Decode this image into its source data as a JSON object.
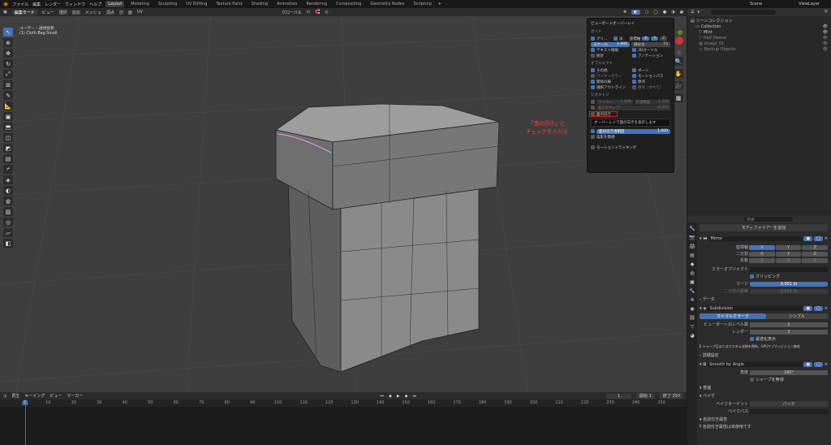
{
  "menubar": {
    "menus": [
      "ファイル",
      "編集",
      "レンダー",
      "ウィンドウ",
      "ヘルプ"
    ],
    "workspaces": [
      "Layout",
      "Modeling",
      "Sculpting",
      "UV Editing",
      "Texture Paint",
      "Shading",
      "Animation",
      "Rendering",
      "Compositing",
      "Geometry Nodes",
      "Scripting"
    ],
    "active_workspace": "Layout",
    "scene_label": "Scene",
    "viewlayer_label": "ViewLayer"
  },
  "viewport_header": {
    "mode": "編集モード",
    "menus": [
      "ビュー",
      "選択",
      "追加",
      "メッシュ",
      "頂点",
      "辺",
      "面",
      "UV"
    ],
    "orientation": "グローバル"
  },
  "viewport": {
    "view_name": "ユーザー・透視投影",
    "object_name": "(1) Cloth Bag.Small"
  },
  "overlay_panel": {
    "title": "ビューポートオーバーレイ",
    "guides_title": "ガイド",
    "grid_label": "グリ...",
    "floor_label": "床",
    "axes_label": "座標軸",
    "axis_x": "X",
    "axis_y": "Y",
    "axis_z": "Z",
    "scale_label": "スケール",
    "scale_value": "1.000",
    "subdiv_label": "細分化",
    "subdiv_value": "10",
    "text_info": "テキスト情報",
    "cursor_3d": "3Dカーソル",
    "stats": "統計",
    "annotations": "アノテーション",
    "objects_title": "オブジェクト",
    "extras": "その他",
    "bones": "ボーン",
    "wireframe": "ワイヤーカラー",
    "motion_paths": "モーションパス",
    "relations": "関係の線",
    "origins": "原点",
    "outline_selected": "選択アウトライン",
    "origins_all": "原点（すべて）",
    "geometry_title": "ジオメトリ",
    "wire_label": "ワイヤー",
    "wire_value": "1.000",
    "opacity_label": "不透明度",
    "opacity_value": "1.000",
    "fade_label": "非アクティブ",
    "fade_value": "0.400",
    "face_orientation": "面の向き",
    "tooltip": "オーバーレイで面の向きを表示します",
    "face_alpha_label": "面の向き透明度",
    "face_alpha_value": "1.000",
    "hidden_wire": "陰影を無視",
    "motion_tracking": "モーショントラッキング"
  },
  "annotation": {
    "line1": "「面の向き」に",
    "line2": "チェックを入れる"
  },
  "outliner": {
    "title": "シーンコレクション",
    "items": [
      {
        "name": "Collection"
      },
      {
        "name": "Mint"
      },
      {
        "name": "Half Sleeve"
      },
      {
        "name": "image_01"
      },
      {
        "name": "Backup Objects"
      }
    ]
  },
  "properties": {
    "search_placeholder": "検索",
    "add_modifier": "モディファイアーを追加",
    "mirror": {
      "name": "Mirror",
      "axis_label": "座標軸",
      "bisect_label": "二分割",
      "flip_label": "反転",
      "x": "X",
      "y": "Y",
      "z": "Z",
      "mirror_object_label": "ミラーオブジェクト",
      "clipping": "クリッピング",
      "merge_label": "マージ",
      "merge_value": "0.001 m",
      "bisect_dist_label": "二分割の距離",
      "bisect_dist_value": "0.001 m",
      "data_label": "データ"
    },
    "subdivision": {
      "name": "Subdivision",
      "catmull": "カトマルクラーク",
      "simple": "シンプル",
      "levels_viewport_label": "ビューポートのレベル数",
      "levels_viewport": "2",
      "render_label": "レンダー",
      "render_levels": "2",
      "optimal_display": "最適化表示",
      "info": "シャープ辺またはカスタム法線を探知。GPUサブディビジョン無効",
      "advanced": "詳細設定"
    },
    "smooth": {
      "name": "Smooth by Angle",
      "angle_label": "角度",
      "angle_value": "180°",
      "sharpen_label": "シャープを無視",
      "section1": "普遍",
      "section2": "ベイク",
      "bake_target_label": "ベイクターゲット",
      "bake_target_value": "パック",
      "bake_path_label": "ベイクパス",
      "section3": "名前付き属性",
      "footer": "名前付き属性は未使用です"
    }
  },
  "timeline": {
    "menus": [
      "再生",
      "キーイング",
      "ビュー",
      "マーカー"
    ],
    "current_frame": "1",
    "start_label": "開始",
    "start": "1",
    "end_label": "終了",
    "end": "250",
    "ticks": [
      "1",
      "10",
      "20",
      "30",
      "40",
      "50",
      "60",
      "70",
      "80",
      "90",
      "100",
      "110",
      "120",
      "130",
      "140",
      "150",
      "160",
      "170",
      "180",
      "190",
      "200",
      "210",
      "220",
      "230",
      "240",
      "250"
    ]
  },
  "status": {
    "version": "4.3.2"
  }
}
